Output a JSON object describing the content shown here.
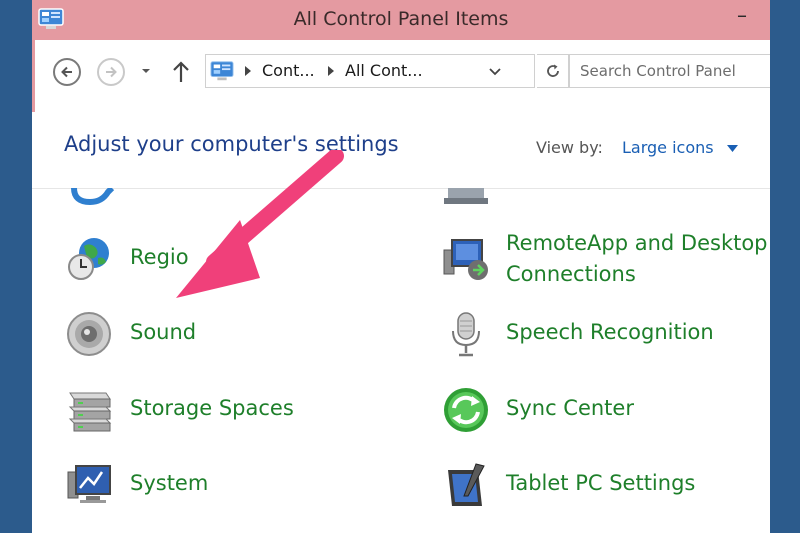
{
  "window": {
    "title": "All Control Panel Items",
    "minimize_glyph": "–"
  },
  "nav": {
    "back_icon": "back-arrow-icon",
    "forward_icon": "forward-arrow-icon",
    "breadcrumbs": [
      "Cont...",
      "All Cont..."
    ],
    "search_placeholder": "Search Control Panel"
  },
  "header": {
    "heading": "Adjust your computer's settings",
    "view_by_label": "View by:",
    "view_by_value": "Large icons"
  },
  "items": {
    "left": [
      {
        "label": "Regio",
        "icon": "region-globe-clock-icon"
      },
      {
        "label": "Sound",
        "icon": "speaker-icon"
      },
      {
        "label": "Storage Spaces",
        "icon": "storage-drives-icon"
      },
      {
        "label": "System",
        "icon": "system-computer-icon"
      }
    ],
    "right": [
      {
        "label_line1": "RemoteApp and Desktop",
        "label_line2": "Connections",
        "icon": "remoteapp-icon"
      },
      {
        "label": "Speech Recognition",
        "icon": "microphone-icon"
      },
      {
        "label": "Sync Center",
        "icon": "sync-icon"
      },
      {
        "label": "Tablet PC Settings",
        "icon": "tablet-pen-icon"
      }
    ]
  },
  "colors": {
    "titlebar": "#e49aa1",
    "link_green": "#1e7f2a",
    "heading_blue": "#1e3f8a",
    "annotation_arrow": "#f0407a"
  }
}
